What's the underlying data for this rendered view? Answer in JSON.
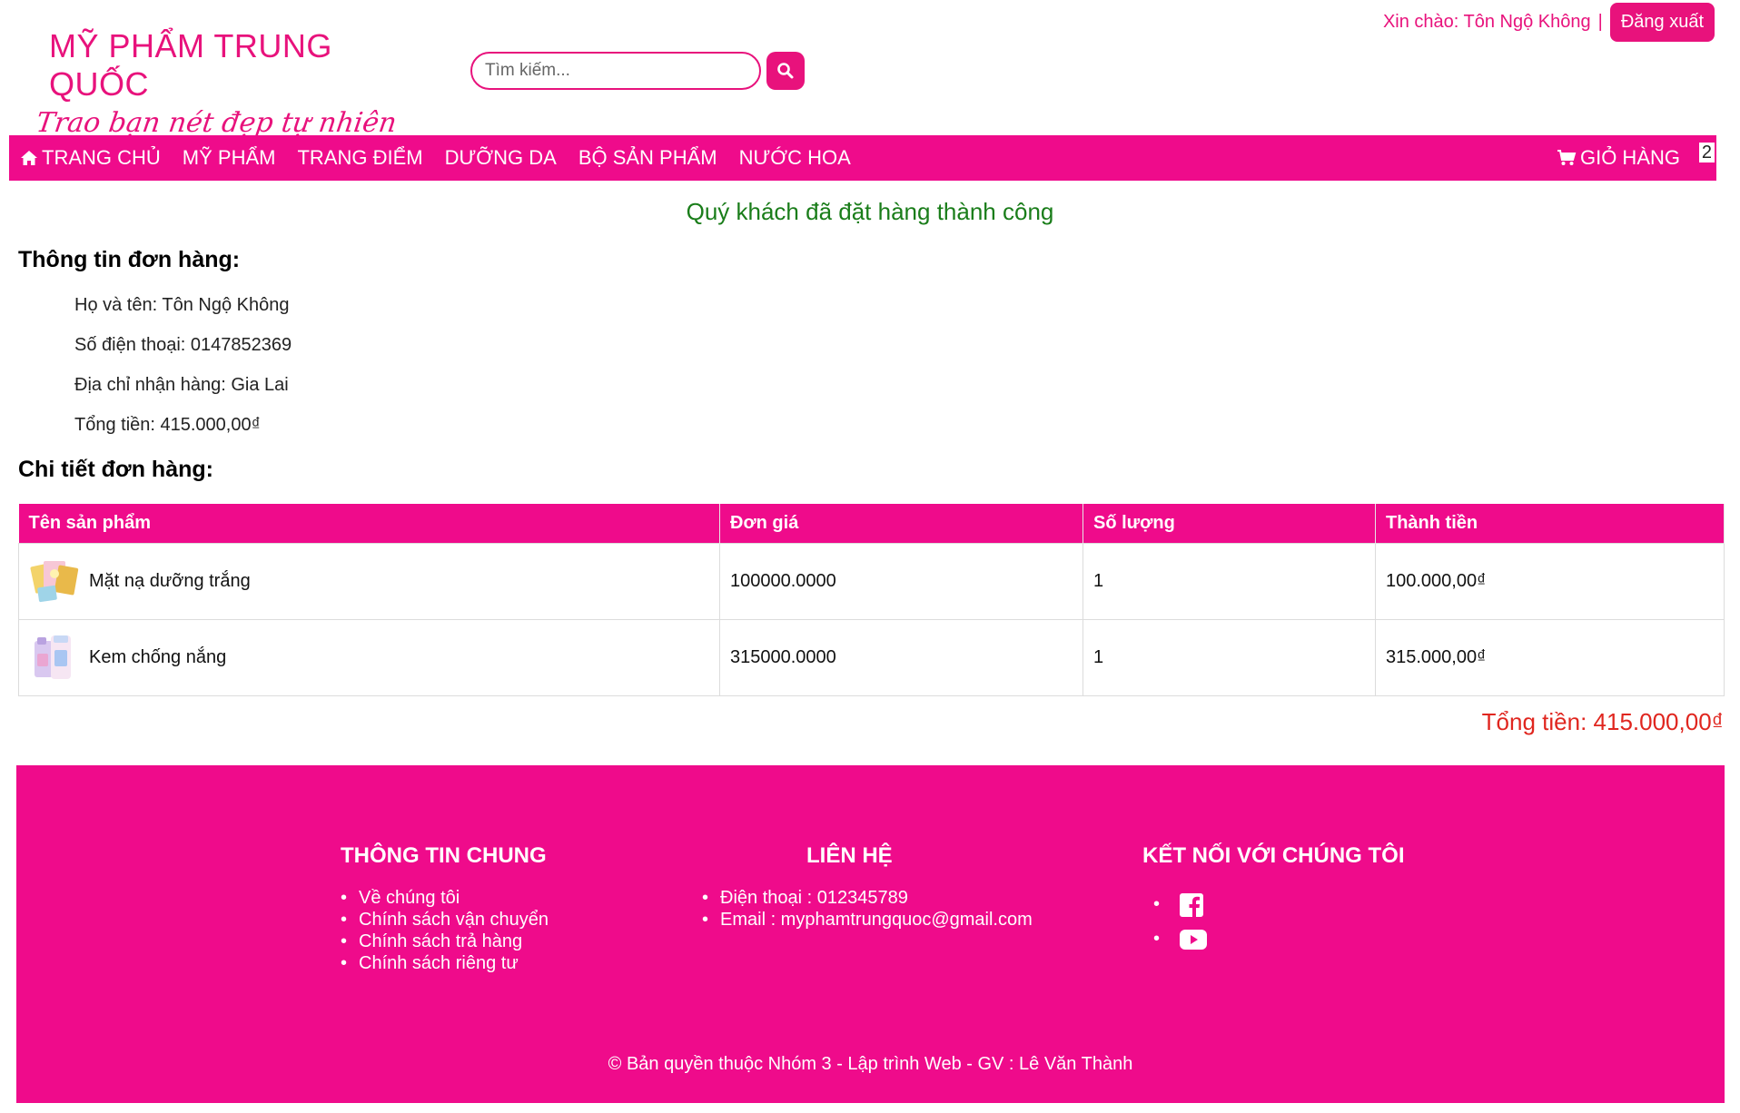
{
  "header": {
    "logo_title": "MỸ PHẨM TRUNG QUỐC",
    "logo_slogan": "Trao bạn nét đẹp tự nhiên",
    "search_placeholder": "Tìm kiếm...",
    "greeting": "Xin chào: Tôn Ngộ Không",
    "separator": "|",
    "logout_label": "Đăng xuất"
  },
  "nav": {
    "items": [
      "TRANG CHỦ",
      "MỸ PHẨM",
      "TRANG ĐIỂM",
      "DƯỠNG DA",
      "BỘ SẢN PHẨM",
      "NƯỚC HOA"
    ],
    "cart_label": "GIỎ HÀNG",
    "cart_count": "2"
  },
  "main": {
    "success_message": "Quý khách đã đặt hàng thành công",
    "order_info_title": "Thông tin đơn hàng:",
    "order_info": {
      "name": "Họ và tên: Tôn Ngộ Không",
      "phone": "Số điện thoại: 0147852369",
      "address": "Địa chỉ nhận hàng: Gia Lai",
      "total": "Tổng tiền: 415.000,00₫"
    },
    "order_detail_title": "Chi tiết đơn hàng:",
    "table": {
      "headers": [
        "Tên sản phẩm",
        "Đơn giá",
        "Số lượng",
        "Thành tiền"
      ],
      "rows": [
        {
          "name": "Mặt nạ dưỡng trắng",
          "price": "100000.0000",
          "qty": "1",
          "subtotal": "100.000,00₫"
        },
        {
          "name": "Kem chống nắng",
          "price": "315000.0000",
          "qty": "1",
          "subtotal": "315.000,00₫"
        }
      ]
    },
    "grand_total": "Tổng tiền: 415.000,00₫"
  },
  "footer": {
    "general_title": "THÔNG TIN CHUNG",
    "general_links": [
      "Về chúng tôi",
      "Chính sách vận chuyển",
      "Chính sách trả hàng",
      "Chính sách riêng tư"
    ],
    "contact_title": "LIÊN HỆ",
    "contact_lines": [
      "Điện thoại : 012345789",
      "Email : myphamtrungquoc@gmail.com"
    ],
    "social_title": "KẾT NỐI VỚI CHÚNG TÔI",
    "social_icons": [
      "facebook-icon",
      "youtube-icon"
    ],
    "copyright": "© Bản quyền thuộc Nhóm 3 - Lập trình Web - GV : Lê Văn Thành"
  },
  "colors": {
    "brand_pink": "#ef0b8b",
    "success_green": "#1a7d1a",
    "total_red": "#e0261f"
  }
}
